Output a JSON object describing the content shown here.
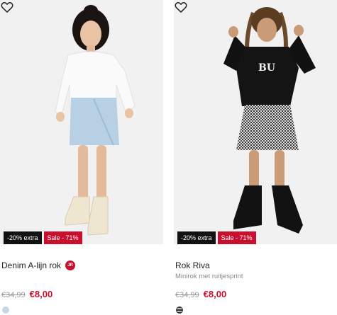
{
  "products": [
    {
      "title": "Denim A-lijn rok",
      "badge_text": "JR",
      "subtitle": "",
      "tags": {
        "extra": "-20% extra",
        "sale": "Sale - 71%"
      },
      "price_old": "€34,99",
      "price_new": "€8,00",
      "swatch_color": "#c6d8e6",
      "favorite_icon": "heart-outline-icon"
    },
    {
      "title": "Rok Riva",
      "badge_text": "",
      "subtitle": "Minirok met ruitjesprint",
      "tags": {
        "extra": "-20% extra",
        "sale": "Sale - 71%"
      },
      "price_old": "€34,99",
      "price_new": "€8,00",
      "swatch_color": "#555555",
      "favorite_icon": "heart-outline-icon"
    }
  ],
  "colors": {
    "sale_red": "#c8102e",
    "extra_black": "#111111",
    "photo_bg": "#f1f1f1"
  }
}
